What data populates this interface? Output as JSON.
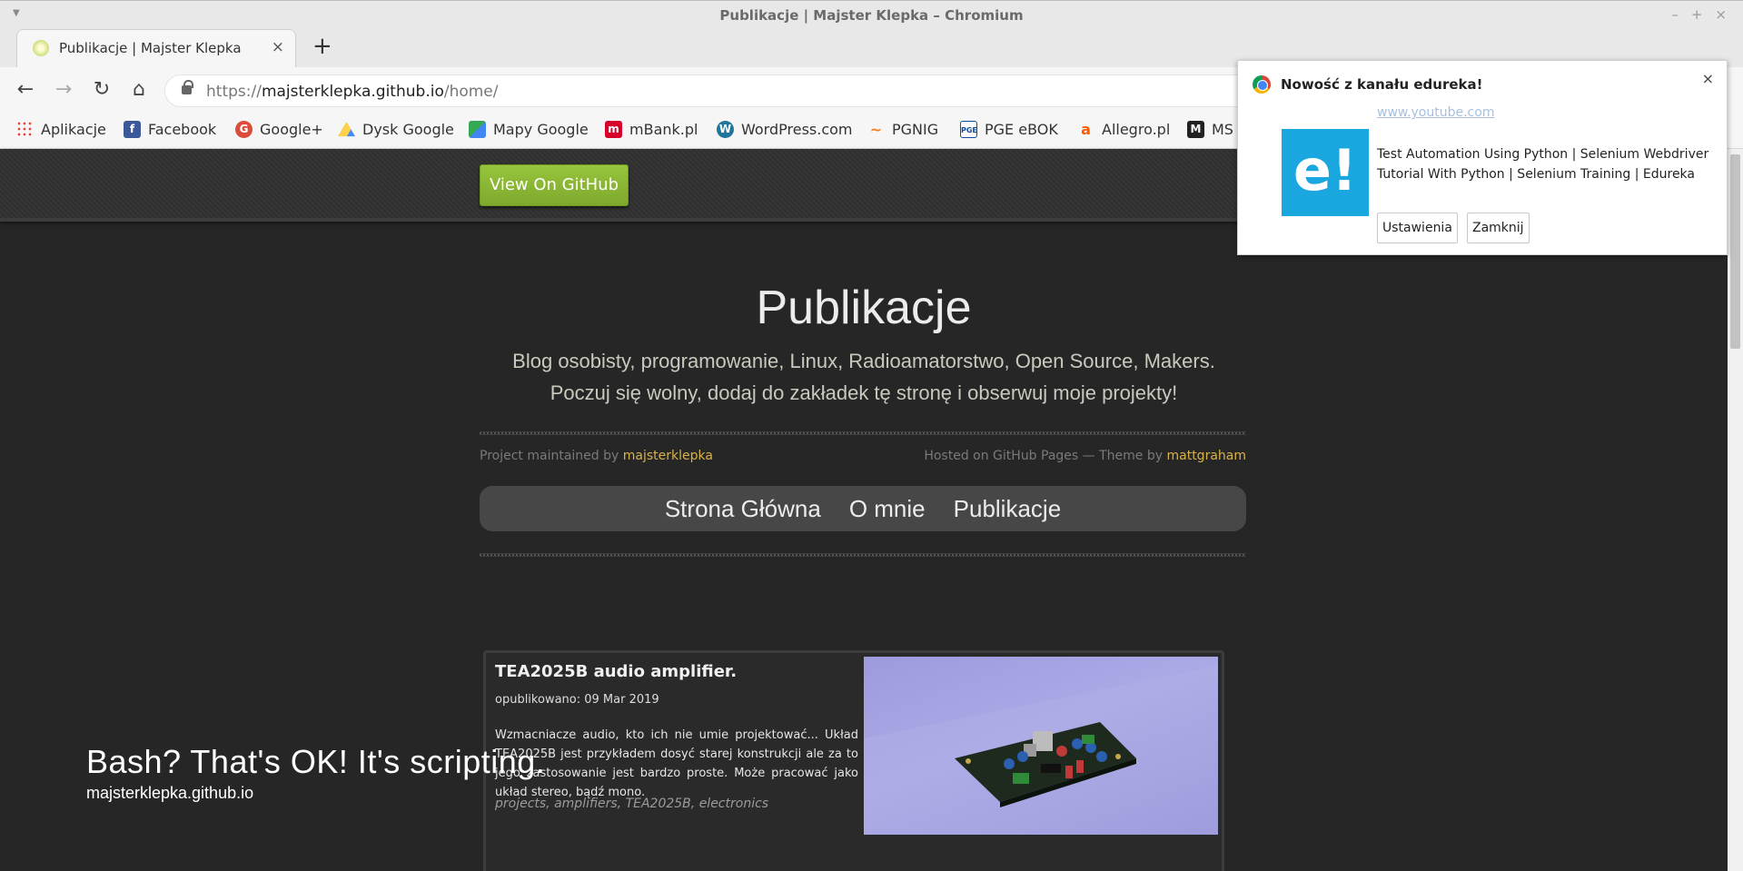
{
  "window": {
    "title": "Publikacje | Majster Klepka – Chromium",
    "controls": [
      "–",
      "+",
      "×"
    ]
  },
  "tab": {
    "title": "Publikacje | Majster Klepka",
    "close": "×",
    "new_tab": "+"
  },
  "toolbar": {
    "back": "←",
    "forward": "→",
    "reload": "↻",
    "home": "⌂",
    "url_scheme": "https://",
    "url_host": "majsterklepka.github.io",
    "url_path": "/home/"
  },
  "bookmarks": [
    {
      "label": "Aplikacje",
      "icon": "apps-grid-icon",
      "color": "#e34234"
    },
    {
      "label": "Facebook",
      "icon": "facebook-icon",
      "color": "#3b5998",
      "glyph": "f"
    },
    {
      "label": "Google+",
      "icon": "google-plus-icon",
      "color": "#dd4b39",
      "glyph": "G"
    },
    {
      "label": "Dysk Google",
      "icon": "google-drive-icon",
      "color": "#1fa463",
      "glyph": "▲"
    },
    {
      "label": "Mapy Google",
      "icon": "google-maps-icon",
      "color": "#34a853",
      "glyph": "◆"
    },
    {
      "label": "mBank.pl",
      "icon": "mbank-icon",
      "color": "#d6002a",
      "glyph": "m"
    },
    {
      "label": "WordPress.com",
      "icon": "wordpress-icon",
      "color": "#21759b",
      "glyph": "W"
    },
    {
      "label": "PGNIG",
      "icon": "pgnig-icon",
      "color": "#f58220",
      "glyph": "~"
    },
    {
      "label": "PGE eBOK",
      "icon": "pge-icon",
      "color": "#0a4da2",
      "glyph": "P"
    },
    {
      "label": "Allegro.pl",
      "icon": "allegro-icon",
      "color": "#ff5a00",
      "glyph": "a"
    },
    {
      "label": "MS",
      "icon": "ms-icon",
      "color": "#222222",
      "glyph": "M"
    }
  ],
  "header": {
    "github_button": "View On GitHub"
  },
  "hero": {
    "title": "Publikacje",
    "subtitle_line1": "Blog osobisty, programowanie, Linux, Radioamatorstwo, Open Source, Makers.",
    "subtitle_line2": "Poczuj się wolny, dodaj do zakładek tę stronę i obserwuj moje projekty!"
  },
  "meta": {
    "maintained_prefix": "Project maintained by ",
    "maintainer": "majsterklepka",
    "hosted_prefix": "Hosted on GitHub Pages — Theme by ",
    "theme_author": "mattgraham"
  },
  "nav": [
    "Strona Główna",
    "O mnie",
    "Publikacje"
  ],
  "post": {
    "title": "TEA2025B audio amplifier.",
    "date": "opublikowano: 09 Mar 2019",
    "excerpt": "Wzmacniacze audio, kto ich nie umie projektować... Układ TEA2025B jest przykładem dosyć starej konstrukcji ale za to jego zastosowanie jest bardzo proste. Może pracować jako układ stereo, bądź mono.",
    "tags": "projects, amplifiers, TEA2025B, electronics"
  },
  "overlay": {
    "text": "Bash? That's OK! It's scripting.",
    "site": "majsterklepka.github.io"
  },
  "notification": {
    "title": "Nowość z kanału edureka!",
    "close": "×",
    "source_link": "www.youtube.com",
    "logo_text": "e!",
    "body": "Test Automation Using Python | Selenium Webdriver Tutorial With Python | Selenium Training | Edureka",
    "settings_button": "Ustawienia",
    "close_button": "Zamknij",
    "accent": "#1aa7e0"
  }
}
